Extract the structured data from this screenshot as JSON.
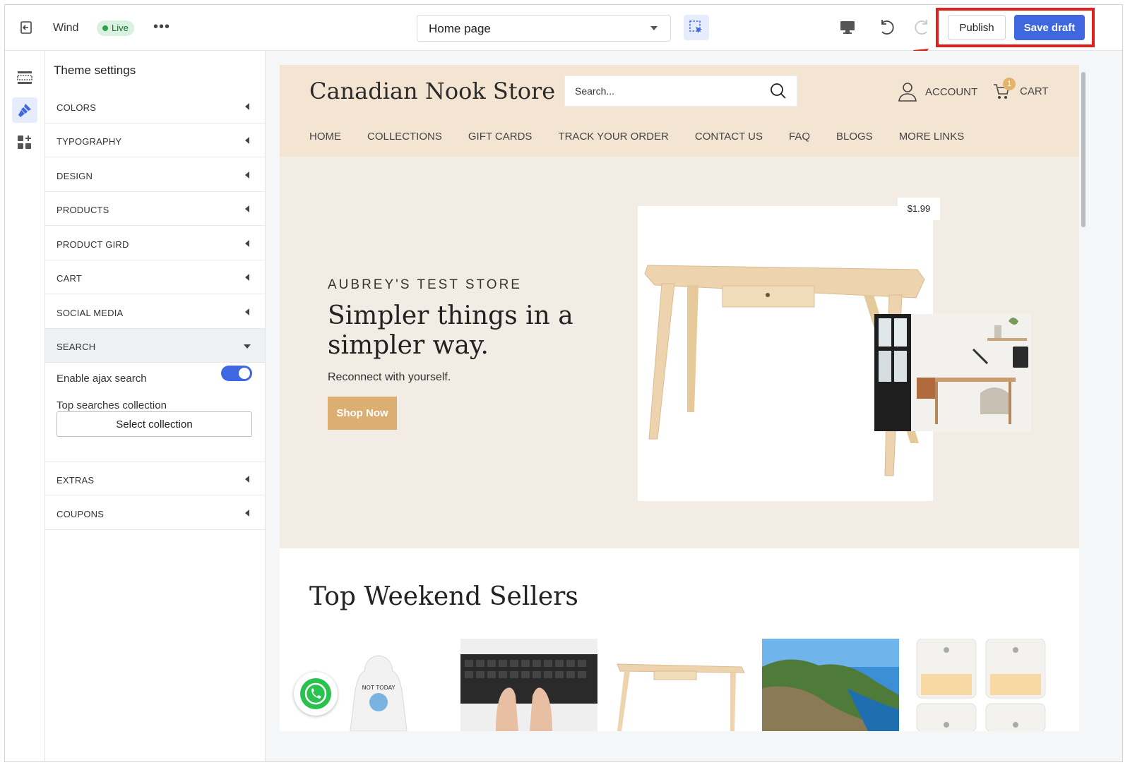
{
  "topbar": {
    "theme_name": "Wind",
    "status_badge": "Live",
    "more_label": "•••",
    "page_selector": "Home page",
    "publish_label": "Publish",
    "save_draft_label": "Save draft"
  },
  "panel": {
    "title": "Theme settings",
    "sections": [
      "COLORS",
      "TYPOGRAPHY",
      "DESIGN",
      "PRODUCTS",
      "PRODUCT GIRD",
      "CART",
      "SOCIAL MEDIA",
      "SEARCH",
      "EXTRAS",
      "COUPONS"
    ],
    "open_section": "SEARCH",
    "search": {
      "enable_ajax_label": "Enable ajax search",
      "enable_ajax_value": true,
      "top_searches_label": "Top searches collection",
      "select_collection_label": "Select collection"
    }
  },
  "store": {
    "name": "Canadian Nook Store",
    "search_placeholder": "Search...",
    "account_label": "ACCOUNT",
    "cart_label": "CART",
    "cart_count": "1",
    "nav": [
      "HOME",
      "COLLECTIONS",
      "GIFT CARDS",
      "TRACK YOUR ORDER",
      "CONTACT US",
      "FAQ",
      "BLOGS",
      "MORE LINKS"
    ],
    "hero": {
      "eyebrow": "AUBREY'S TEST STORE",
      "title": "Simpler things in a simpler way.",
      "subtitle": "Reconnect with yourself.",
      "button": "Shop Now",
      "price": "$1.99"
    },
    "section_title": "Top Weekend Sellers",
    "colors": {
      "header_bg": "#f4e5d3",
      "hero_bg": "#f3ece4",
      "accent": "#ddae71",
      "primary": "#3e67e0",
      "annotation": "#e0201b"
    }
  }
}
